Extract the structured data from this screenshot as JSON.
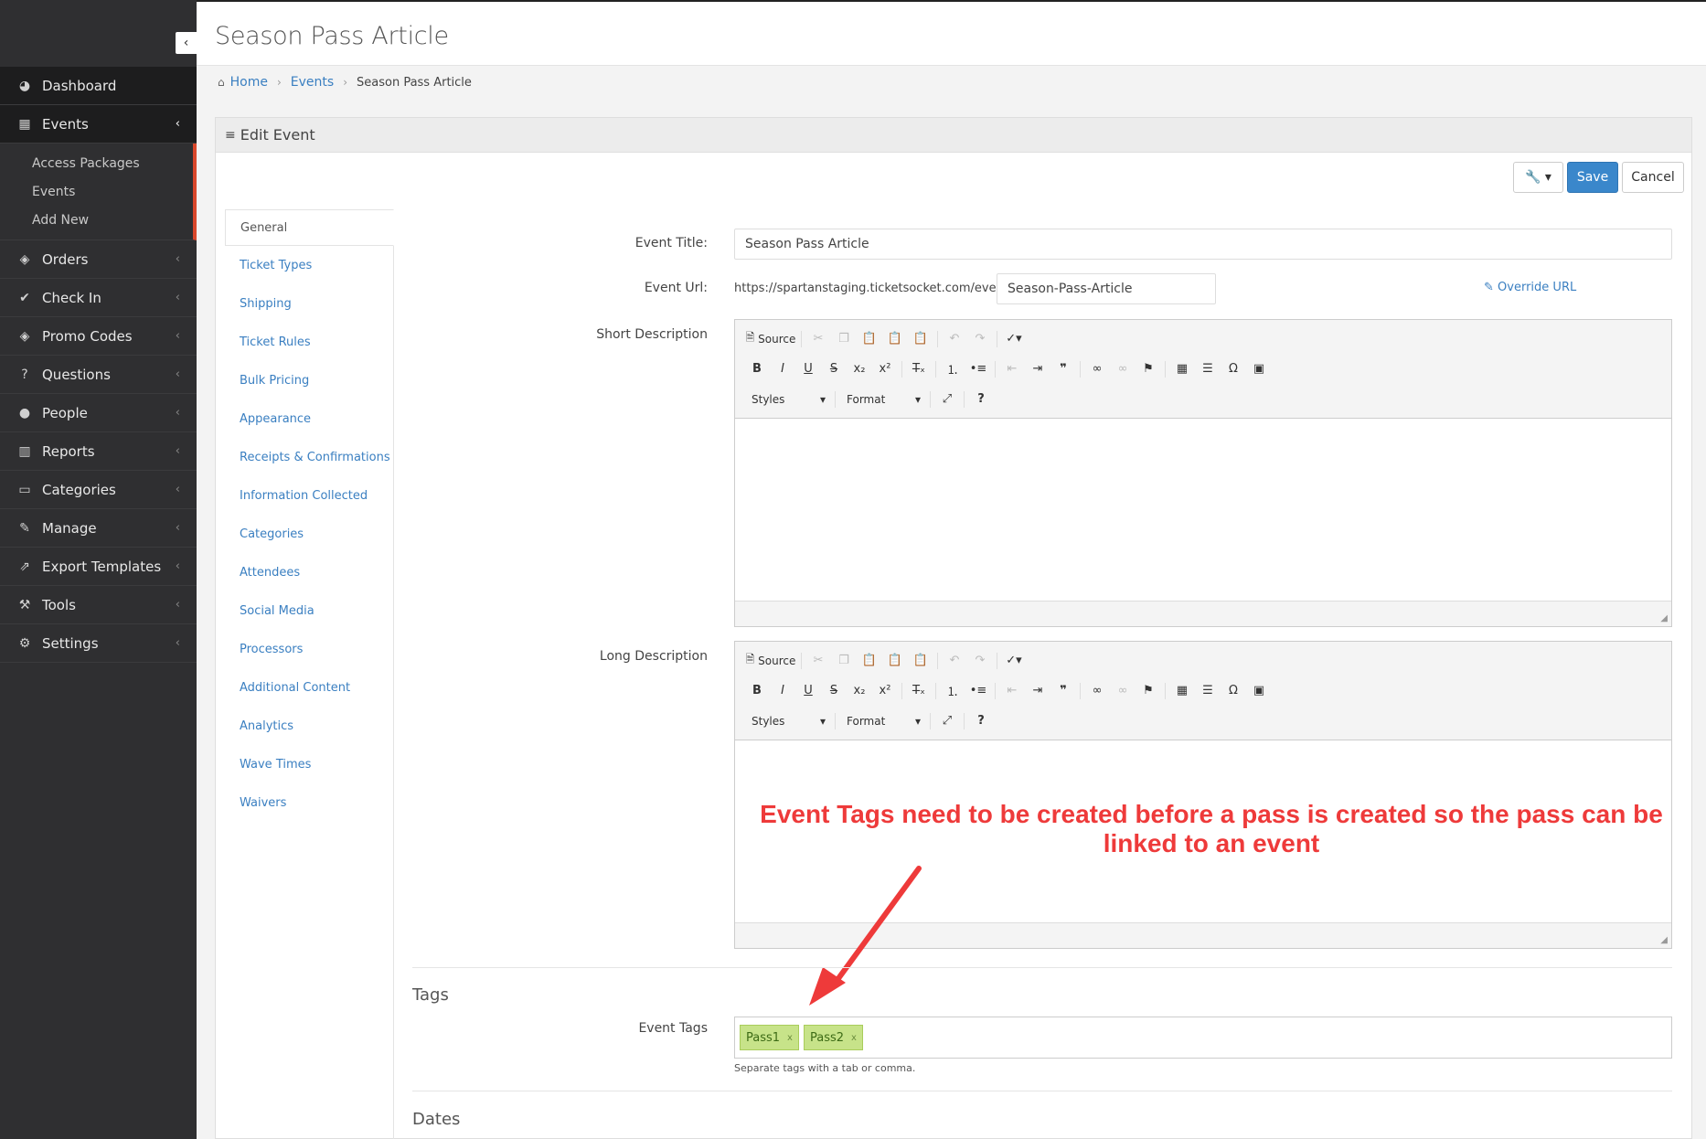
{
  "page": {
    "title": "Season Pass Article"
  },
  "breadcrumb": {
    "home": "Home",
    "events": "Events",
    "current": "Season Pass Article"
  },
  "sidebar": {
    "items": [
      {
        "label": "Dashboard",
        "icon": "dashboard-icon"
      },
      {
        "label": "Events",
        "icon": "calendar-icon"
      },
      {
        "label": "Orders",
        "icon": "tag-icon"
      },
      {
        "label": "Check In",
        "icon": "check-icon"
      },
      {
        "label": "Promo Codes",
        "icon": "tags-icon"
      },
      {
        "label": "Questions",
        "icon": "question-circle-icon"
      },
      {
        "label": "People",
        "icon": "user-icon"
      },
      {
        "label": "Reports",
        "icon": "bar-chart-icon"
      },
      {
        "label": "Categories",
        "icon": "folder-open-icon"
      },
      {
        "label": "Manage",
        "icon": "edit-icon"
      },
      {
        "label": "Export Templates",
        "icon": "external-link-icon"
      },
      {
        "label": "Tools",
        "icon": "wrench-icon"
      },
      {
        "label": "Settings",
        "icon": "cogs-icon"
      }
    ],
    "events_submenu": [
      "Access Packages",
      "Events",
      "Add New"
    ]
  },
  "panel": {
    "heading": "Edit Event",
    "save_label": "Save",
    "cancel_label": "Cancel"
  },
  "tabs": [
    "General",
    "Ticket Types",
    "Shipping",
    "Ticket Rules",
    "Bulk Pricing",
    "Appearance",
    "Receipts & Confirmations",
    "Information Collected",
    "Categories",
    "Attendees",
    "Social Media",
    "Processors",
    "Additional Content",
    "Analytics",
    "Wave Times",
    "Waivers"
  ],
  "form": {
    "event_title_label": "Event Title:",
    "event_title_value": "Season Pass Article",
    "event_url_label": "Event Url:",
    "event_url_prefix": "https://spartanstaging.ticketsocket.com/event/",
    "event_url_slug": "Season-Pass-Article",
    "override_url_label": "Override URL",
    "short_description_label": "Short Description",
    "long_description_label": "Long Description"
  },
  "editor": {
    "source_label": "Source",
    "styles_label": "Styles",
    "format_label": "Format"
  },
  "tags_section": {
    "title": "Tags",
    "event_tags_label": "Event Tags",
    "tags": [
      "Pass1",
      "Pass2"
    ],
    "help": "Separate tags with a tab or comma."
  },
  "dates_section": {
    "title": "Dates"
  },
  "annotation": {
    "text": "Event Tags need to be created before a pass is created so the pass can be linked to an event",
    "color": "#ee3a3a"
  },
  "colors": {
    "sidebar_bg": "#2f2f31",
    "accent_red": "#d9472b",
    "link_blue": "#3a7fc1",
    "save_blue": "#3a87cb",
    "tag_green": "#c7e389"
  }
}
